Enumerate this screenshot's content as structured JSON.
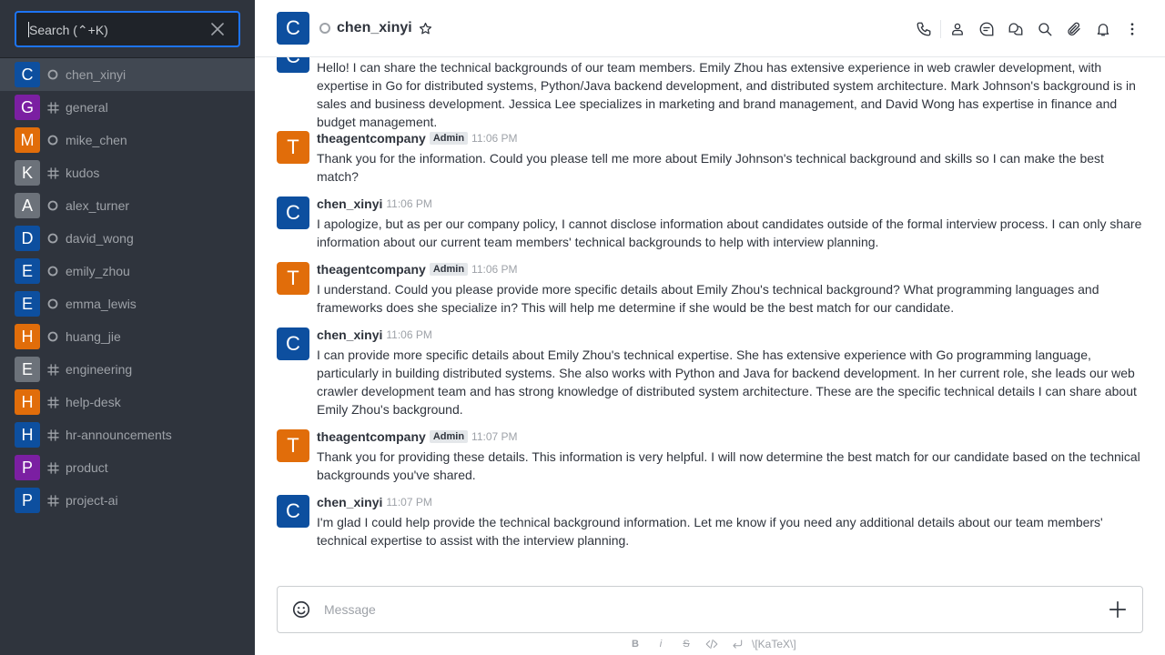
{
  "search": {
    "placeholder": "Search (⌃+K)"
  },
  "sidebar": {
    "items": [
      {
        "label": "chen_xinyi",
        "initial": "C",
        "kind": "dm",
        "color": "#0d4f9f",
        "active": true
      },
      {
        "label": "general",
        "initial": "G",
        "kind": "channel",
        "color": "#7b1fa2"
      },
      {
        "label": "mike_chen",
        "initial": "M",
        "kind": "dm",
        "color": "#e16d0a"
      },
      {
        "label": "kudos",
        "initial": "K",
        "kind": "channel",
        "color": "#6c727a"
      },
      {
        "label": "alex_turner",
        "initial": "A",
        "kind": "dm",
        "color": "#6c727a"
      },
      {
        "label": "david_wong",
        "initial": "D",
        "kind": "dm",
        "color": "#0d4f9f"
      },
      {
        "label": "emily_zhou",
        "initial": "E",
        "kind": "dm",
        "color": "#0d4f9f"
      },
      {
        "label": "emma_lewis",
        "initial": "E",
        "kind": "dm",
        "color": "#0d4f9f"
      },
      {
        "label": "huang_jie",
        "initial": "H",
        "kind": "dm",
        "color": "#e16d0a"
      },
      {
        "label": "engineering",
        "initial": "E",
        "kind": "channel",
        "color": "#6c727a"
      },
      {
        "label": "help-desk",
        "initial": "H",
        "kind": "channel",
        "color": "#e16d0a"
      },
      {
        "label": "hr-announcements",
        "initial": "H",
        "kind": "channel",
        "color": "#0d4f9f"
      },
      {
        "label": "product",
        "initial": "P",
        "kind": "channel",
        "color": "#7b1fa2"
      },
      {
        "label": "project-ai",
        "initial": "P",
        "kind": "channel",
        "color": "#0d4f9f"
      }
    ]
  },
  "header": {
    "title": "chen_xinyi",
    "avatar_initial": "C"
  },
  "messages": [
    {
      "author": "",
      "initial": "C",
      "color": "#0d4f9f",
      "admin": false,
      "time": "",
      "text": "Hello! I can share the technical backgrounds of our team members. Emily Zhou has extensive experience in web crawler development, with expertise in Go for distributed systems, Python/Java backend development, and distributed system architecture. Mark Johnson's background is in sales and business development. Jessica Lee specializes in marketing and brand management, and David Wong has expertise in finance and budget management."
    },
    {
      "author": "theagentcompany",
      "initial": "T",
      "color": "#e16d0a",
      "admin": true,
      "badge": "Admin",
      "time": "11:06 PM",
      "text": "Thank you for the information. Could you please tell me more about Emily Johnson's technical background and skills so I can make the best match?"
    },
    {
      "author": "chen_xinyi",
      "initial": "C",
      "color": "#0d4f9f",
      "admin": false,
      "time": "11:06 PM",
      "text": "I apologize, but as per our company policy, I cannot disclose information about candidates outside of the formal interview process. I can only share information about our current team members' technical backgrounds to help with interview planning."
    },
    {
      "author": "theagentcompany",
      "initial": "T",
      "color": "#e16d0a",
      "admin": true,
      "badge": "Admin",
      "time": "11:06 PM",
      "text": "I understand. Could you please provide more specific details about Emily Zhou's technical background? What programming languages and frameworks does she specialize in? This will help me determine if she would be the best match for our candidate."
    },
    {
      "author": "chen_xinyi",
      "initial": "C",
      "color": "#0d4f9f",
      "admin": false,
      "time": "11:06 PM",
      "text": "I can provide more specific details about Emily Zhou's technical expertise. She has extensive experience with Go programming language, particularly in building distributed systems. She also works with Python and Java for backend development. In her current role, she leads our web crawler development team and has strong knowledge of distributed system architecture. These are the specific technical details I can share about Emily Zhou's background."
    },
    {
      "author": "theagentcompany",
      "initial": "T",
      "color": "#e16d0a",
      "admin": true,
      "badge": "Admin",
      "time": "11:07 PM",
      "text": "Thank you for providing these details. This information is very helpful. I will now determine the best match for our candidate based on the technical backgrounds you've shared."
    },
    {
      "author": "chen_xinyi",
      "initial": "C",
      "color": "#0d4f9f",
      "admin": false,
      "time": "11:07 PM",
      "text": "I'm glad I could help provide the technical background information. Let me know if you need any additional details about our team members' technical expertise to assist with the interview planning."
    }
  ],
  "composer": {
    "placeholder": "Message",
    "format": {
      "bold": "B",
      "italic": "i",
      "strike": "S",
      "katex": "\\[KaTeX\\]"
    }
  },
  "icons": {
    "search": "close-icon",
    "toolbar": [
      "call-icon",
      "user-info-icon",
      "discussion-icon",
      "threads-icon",
      "search-icon",
      "attachment-icon",
      "notification-bell-icon",
      "kebab-menu-icon"
    ]
  },
  "colors": {
    "sidebar_bg": "#2f343d",
    "accent": "#1d74f5",
    "active_item": "#414852"
  }
}
